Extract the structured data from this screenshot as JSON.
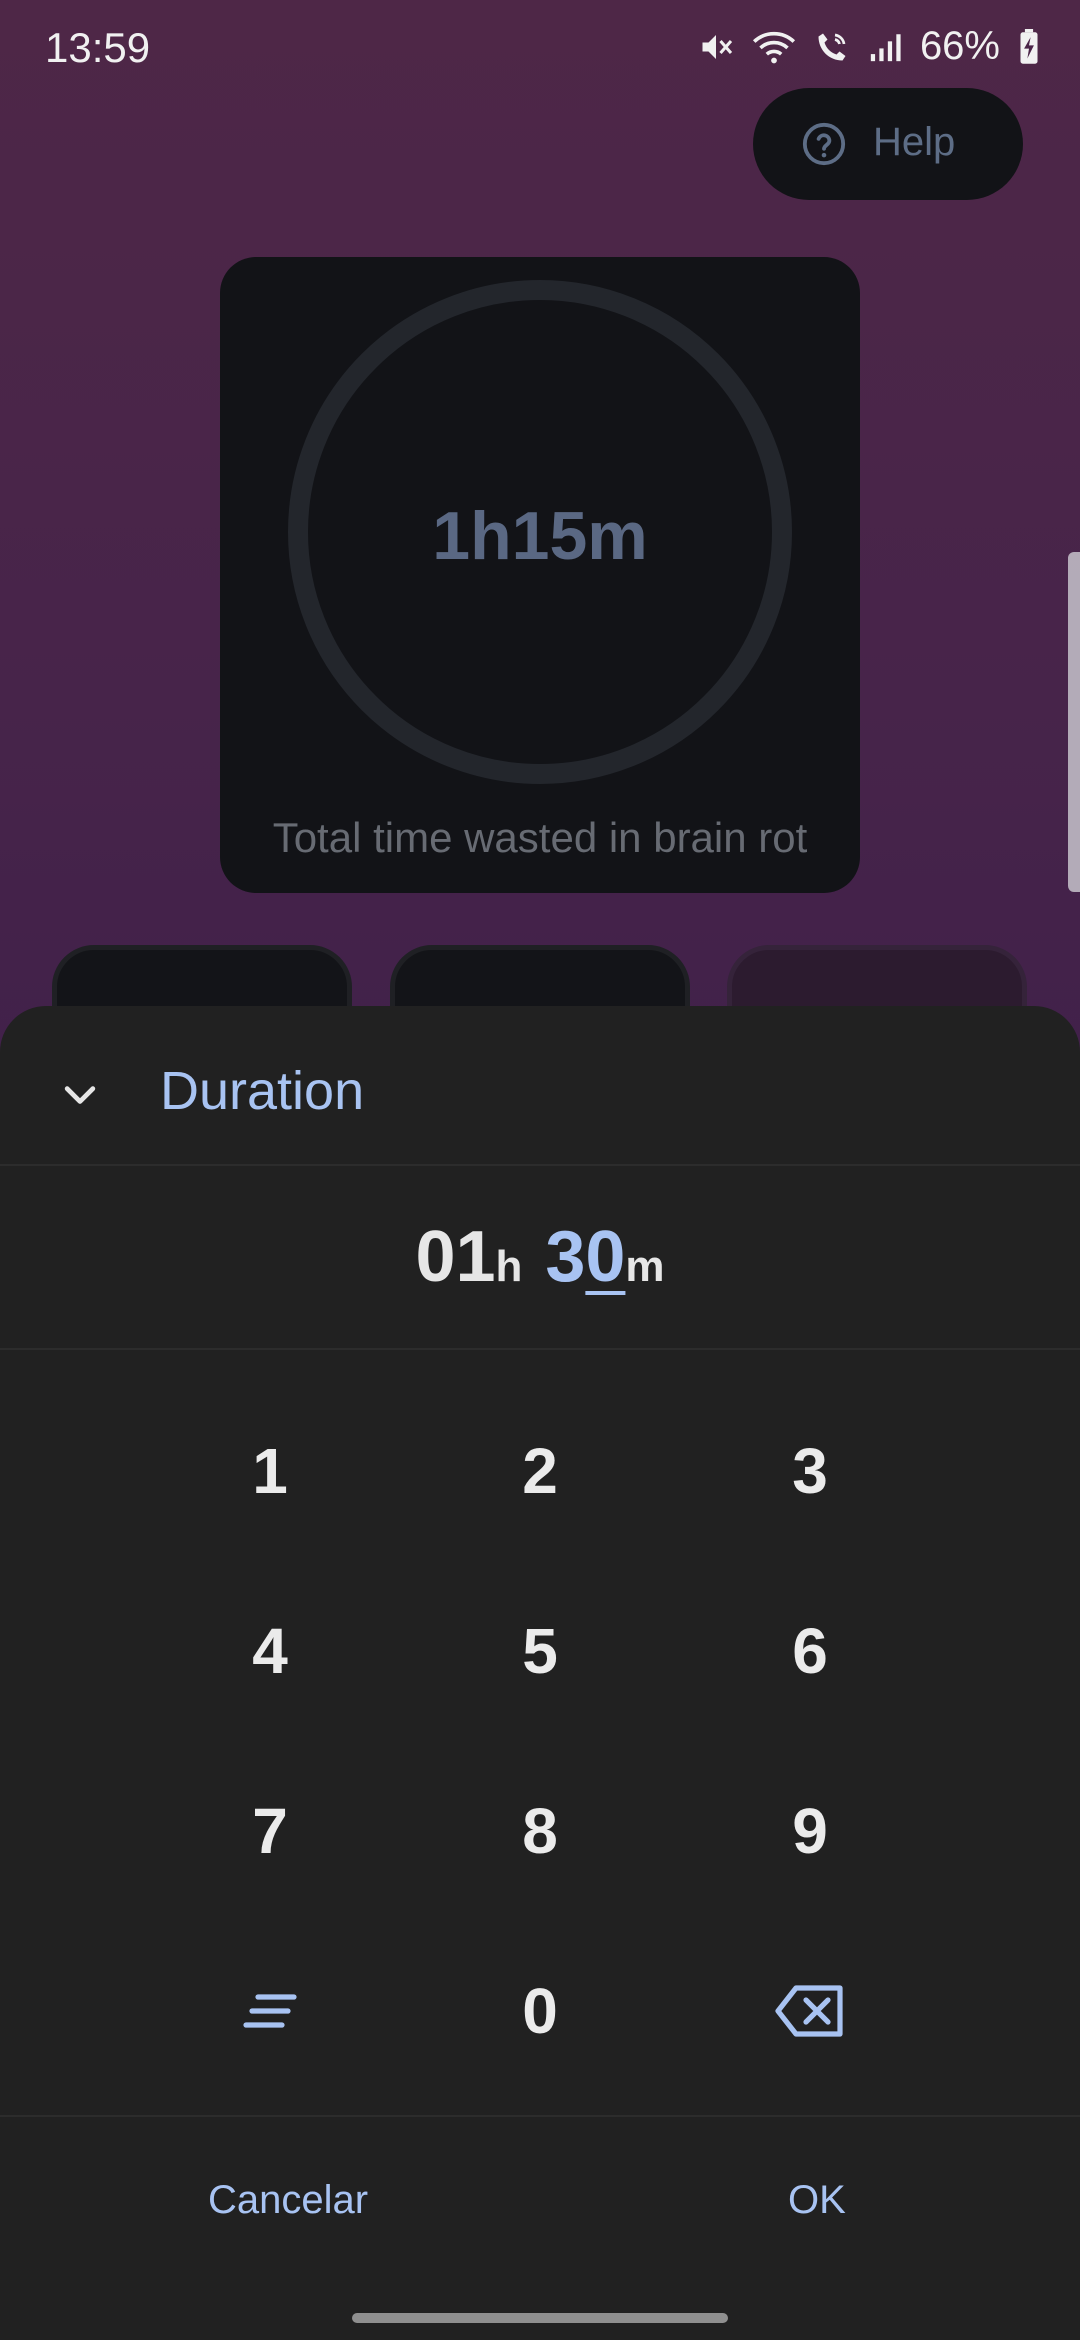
{
  "status_bar": {
    "time": "13:59",
    "battery": "66%",
    "icons": [
      "mute-icon",
      "wifi-icon",
      "wifi-calling-icon",
      "signal-icon",
      "battery-charging-icon"
    ]
  },
  "help": {
    "label": "Help",
    "icon": "help-circle-icon"
  },
  "stats": {
    "value": "1h15m",
    "caption": "Total time wasted in brain rot"
  },
  "dialog": {
    "title": "Duration",
    "collapse_icon": "chevron-down-icon",
    "duration": {
      "hours": "01",
      "hours_unit": "h",
      "minutes_lead": "3",
      "minutes_cursor": "0",
      "minutes_unit": "m"
    },
    "keys": [
      "1",
      "2",
      "3",
      "4",
      "5",
      "6",
      "7",
      "8",
      "9",
      "0"
    ],
    "special_keys": {
      "left": "text-input-icon",
      "right": "backspace-icon"
    },
    "cancel_label": "Cancelar",
    "ok_label": "OK"
  },
  "colors": {
    "accent": "#a8c3f2",
    "sheet_bg": "#212121",
    "card_bg": "#121317",
    "bg_top": "#4e2747",
    "bg_bottom": "#33193f"
  }
}
